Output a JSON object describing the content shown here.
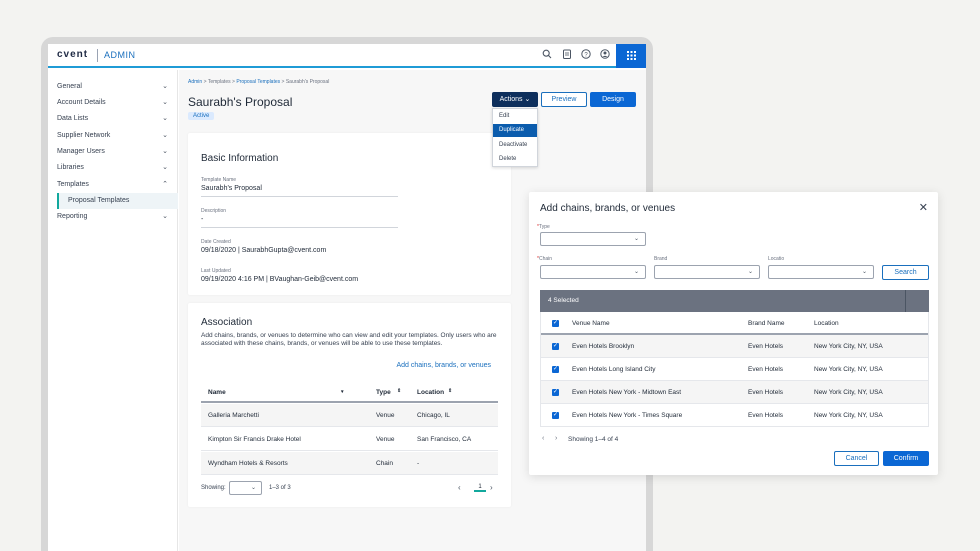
{
  "header": {
    "brand": "cvent",
    "section": "ADMIN",
    "icons": [
      "search-icon",
      "clipboard-icon",
      "help-icon",
      "user-icon",
      "apps-grid-icon"
    ]
  },
  "sidebar": {
    "items": [
      {
        "label": "General"
      },
      {
        "label": "Account Details"
      },
      {
        "label": "Data Lists"
      },
      {
        "label": "Supplier Network"
      },
      {
        "label": "Manager Users"
      },
      {
        "label": "Libraries"
      },
      {
        "label": "Templates"
      },
      {
        "label": "Reporting"
      }
    ],
    "active_sub": "Proposal Templates"
  },
  "breadcrumb": {
    "items": [
      "Admin",
      "Templates",
      "Proposal Templates",
      "Saurabh's Proposal"
    ],
    "sep": ">"
  },
  "page": {
    "title": "Saurabh's Proposal",
    "status": "Active"
  },
  "toolbar": {
    "actions_label": "Actions",
    "preview_label": "Preview",
    "design_label": "Design",
    "menu": [
      "Edit",
      "Duplicate",
      "Deactivate",
      "Delete"
    ]
  },
  "basic": {
    "title": "Basic Information",
    "template_name_label": "Template Name",
    "template_name": "Saurabh's Proposal",
    "description_label": "Description",
    "description": "-",
    "date_created_label": "Date Created",
    "date_created": "09/18/2020 | SaurabhGupta@cvent.com",
    "last_updated_label": "Last Updated",
    "last_updated": "09/19/2020 4:16 PM | BVaughan-Geib@cvent.com"
  },
  "association": {
    "title": "Association",
    "description": "Add chains, brands, or venues to determine who can view and edit your templates. Only users who are associated with these chains, brands, or venues will be able to use these templates.",
    "add_link": "Add chains, brands, or venues",
    "columns": [
      "Name",
      "Type",
      "Location"
    ],
    "rows": [
      [
        "Galleria Marchetti",
        "Venue",
        "Chicago, IL"
      ],
      [
        "Kimpton Sir Francis Drake Hotel",
        "Venue",
        "San Francisco, CA"
      ],
      [
        "Wyndham Hotels & Resorts",
        "Chain",
        "-"
      ]
    ],
    "showing_label": "Showing:",
    "count": "1–3 of 3",
    "page": "1"
  },
  "modal": {
    "title": "Add chains, brands, or venues",
    "type_label": "Type",
    "chain_label": "Chain",
    "brand_label": "Brand",
    "location_label": "Locatio",
    "search_label": "Search",
    "selected_text": "4 Selected",
    "columns": [
      "Venue Name",
      "Brand Name",
      "Location"
    ],
    "rows": [
      [
        "Even Hotels Brooklyn",
        "Even Hotels",
        "New York City, NY, USA"
      ],
      [
        "Even Hotels Long Island City",
        "Even Hotels",
        "New York City, NY, USA"
      ],
      [
        "Even Hotels New York - Midtown East",
        "Even Hotels",
        "New York City, NY, USA"
      ],
      [
        "Even Hotels New York - Times Square",
        "Even Hotels",
        "New York City, NY, USA"
      ]
    ],
    "showing": "Showing 1–4 of 4",
    "cancel_label": "Cancel",
    "confirm_label": "Confirm"
  }
}
